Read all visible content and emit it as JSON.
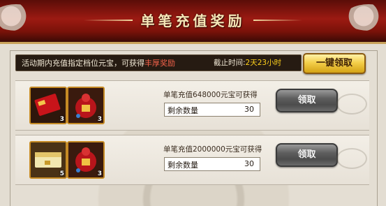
{
  "header": {
    "title": "单笔充值奖励"
  },
  "info_bar": {
    "text_main": "活动期内充值指定档位元宝，可获得",
    "text_highlight": "丰厚奖励",
    "deadline_label": "截止时间:",
    "deadline_value": "2天23小时"
  },
  "claim_all_label": "一键领取",
  "rewards": [
    {
      "requirement": "单笔充值648000元宝可获得",
      "remaining_label": "剩余数量",
      "remaining_value": "30",
      "claim_label": "领取",
      "items": [
        {
          "icon": "red-envelope-icon",
          "count": "3"
        },
        {
          "icon": "red-gift-bag-icon",
          "count": "3"
        }
      ]
    },
    {
      "requirement": "单笔充值2000000元宝可获得",
      "remaining_label": "剩余数量",
      "remaining_value": "30",
      "claim_label": "领取",
      "items": [
        {
          "icon": "gold-envelope-icon",
          "count": "5"
        },
        {
          "icon": "red-gift-bag-icon",
          "count": "3"
        }
      ]
    }
  ],
  "colors": {
    "header_red": "#9c1a12",
    "highlight_red": "#f2624a",
    "highlight_yellow": "#ffd21c",
    "gold_button": "#f4cf4a"
  }
}
